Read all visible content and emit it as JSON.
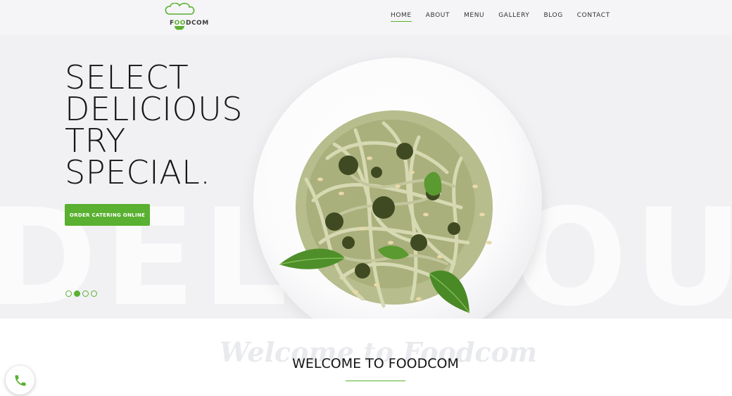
{
  "header": {
    "logo": {
      "text_prefix": "F",
      "text_accent": "OO",
      "text_suffix": "DCOM"
    },
    "nav": [
      {
        "label": "HOME",
        "active": true
      },
      {
        "label": "ABOUT",
        "active": false
      },
      {
        "label": "MENU",
        "active": false
      },
      {
        "label": "GALLERY",
        "active": false
      },
      {
        "label": "BLOG",
        "active": false
      },
      {
        "label": "CONTACT",
        "active": false
      }
    ]
  },
  "hero": {
    "background_word": "DELICIOUS",
    "headline": [
      "SELECT",
      "DELICIOUS",
      "TRY",
      "SPECIAL."
    ],
    "cta_label": "ORDER CATERING ONLINE",
    "slide_count": 4,
    "active_slide": 2
  },
  "welcome": {
    "script_text": "Welcome to Foodcom",
    "title": "WELCOME TO FOODCOM"
  },
  "colors": {
    "accent": "#5ab030",
    "hero_bg": "#f1f1f4",
    "text": "#151515"
  },
  "icons": {
    "logo": "chef-hat-icon",
    "phone": "phone-icon"
  }
}
